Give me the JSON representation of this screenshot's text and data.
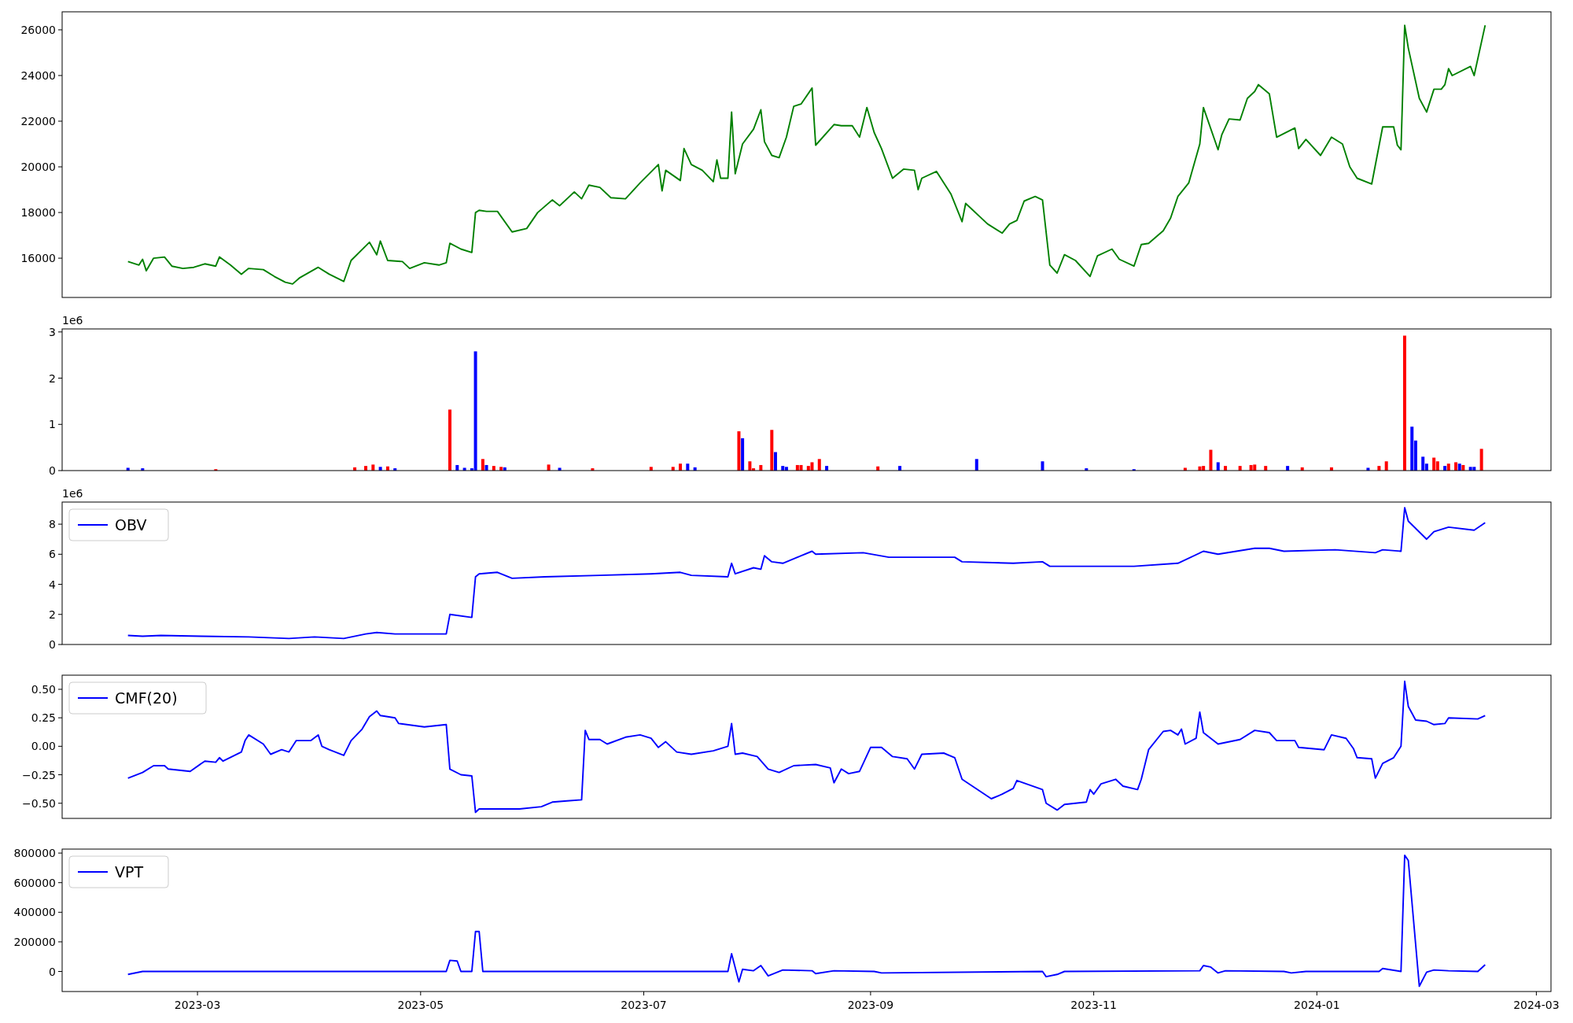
{
  "panels": [
    {
      "chart_data": {
        "type": "line",
        "xlim": [
          "2023-01-23",
          "2024-03-05"
        ],
        "ylim": [
          14280,
          26790
        ],
        "yticks": [
          16000,
          18000,
          20000,
          22000,
          24000,
          26000
        ],
        "x": [
          "2023-02-10",
          "2023-02-13",
          "2023-02-14",
          "2023-02-15",
          "2023-02-17",
          "2023-02-20",
          "2023-02-22",
          "2023-02-25",
          "2023-02-28",
          "2023-03-03",
          "2023-03-06",
          "2023-03-07",
          "2023-03-10",
          "2023-03-13",
          "2023-03-15",
          "2023-03-19",
          "2023-03-22",
          "2023-03-25",
          "2023-03-27",
          "2023-03-29",
          "2023-04-03",
          "2023-04-06",
          "2023-04-10",
          "2023-04-12",
          "2023-04-17",
          "2023-04-19",
          "2023-04-20",
          "2023-04-22",
          "2023-04-26",
          "2023-04-28",
          "2023-05-02",
          "2023-05-06",
          "2023-05-08",
          "2023-05-09",
          "2023-05-12",
          "2023-05-15",
          "2023-05-16",
          "2023-05-17",
          "2023-05-19",
          "2023-05-22",
          "2023-05-26",
          "2023-05-30",
          "2023-06-02",
          "2023-06-06",
          "2023-06-08",
          "2023-06-12",
          "2023-06-14",
          "2023-06-16",
          "2023-06-19",
          "2023-06-22",
          "2023-06-26",
          "2023-06-30",
          "2023-07-05",
          "2023-07-06",
          "2023-07-07",
          "2023-07-11",
          "2023-07-12",
          "2023-07-14",
          "2023-07-17",
          "2023-07-20",
          "2023-07-21",
          "2023-07-22",
          "2023-07-24",
          "2023-07-25",
          "2023-07-26",
          "2023-07-28",
          "2023-07-31",
          "2023-08-02",
          "2023-08-03",
          "2023-08-05",
          "2023-08-07",
          "2023-08-09",
          "2023-08-11",
          "2023-08-13",
          "2023-08-16",
          "2023-08-17",
          "2023-08-22",
          "2023-08-24",
          "2023-08-27",
          "2023-08-29",
          "2023-08-31",
          "2023-09-02",
          "2023-09-04",
          "2023-09-07",
          "2023-09-10",
          "2023-09-13",
          "2023-09-14",
          "2023-09-15",
          "2023-09-19",
          "2023-09-23",
          "2023-09-26",
          "2023-09-27",
          "2023-10-03",
          "2023-10-07",
          "2023-10-09",
          "2023-10-11",
          "2023-10-13",
          "2023-10-16",
          "2023-10-18",
          "2023-10-20",
          "2023-10-22",
          "2023-10-24",
          "2023-10-27",
          "2023-10-31",
          "2023-11-02",
          "2023-11-06",
          "2023-11-08",
          "2023-11-12",
          "2023-11-14",
          "2023-11-16",
          "2023-11-20",
          "2023-11-22",
          "2023-11-24",
          "2023-11-27",
          "2023-11-30",
          "2023-12-01",
          "2023-12-05",
          "2023-12-06",
          "2023-12-08",
          "2023-12-11",
          "2023-12-13",
          "2023-12-15",
          "2023-12-16",
          "2023-12-19",
          "2023-12-21",
          "2023-12-26",
          "2023-12-27",
          "2023-12-29",
          "2024-01-02",
          "2024-01-05",
          "2024-01-08",
          "2024-01-10",
          "2024-01-12",
          "2024-01-16",
          "2024-01-19",
          "2024-01-22",
          "2024-01-23",
          "2024-01-24",
          "2024-01-25",
          "2024-01-26",
          "2024-01-29",
          "2024-01-31",
          "2024-02-02",
          "2024-02-04",
          "2024-02-05",
          "2024-02-06",
          "2024-02-07",
          "2024-02-12",
          "2024-02-13",
          "2024-02-16"
        ],
        "series": [
          {
            "color": "#008000",
            "values": [
              15850,
              15700,
              15950,
              15450,
              16000,
              16050,
              15650,
              15550,
              15600,
              15750,
              15650,
              16050,
              15700,
              15300,
              15550,
              15500,
              15200,
              14950,
              14870,
              15150,
              15600,
              15300,
              14980,
              15900,
              16700,
              16150,
              16750,
              15900,
              15850,
              15550,
              15800,
              15700,
              15800,
              16650,
              16400,
              16250,
              18000,
              18100,
              18050,
              18050,
              17150,
              17300,
              18000,
              18550,
              18300,
              18900,
              18600,
              19200,
              19100,
              18650,
              18600,
              19300,
              20100,
              18950,
              19850,
              19400,
              20800,
              20100,
              19850,
              19350,
              20300,
              19500,
              19500,
              22400,
              19700,
              21000,
              21650,
              22500,
              21100,
              20500,
              20400,
              21300,
              22650,
              22750,
              23450,
              20950,
              21850,
              21800,
              21800,
              21300,
              22600,
              21500,
              20800,
              19500,
              19900,
              19850,
              19000,
              19500,
              19800,
              18800,
              17600,
              18400,
              17500,
              17100,
              17500,
              17650,
              18500,
              18700,
              18550,
              15700,
              15350,
              16150,
              15900,
              15200,
              16100,
              16400,
              15950,
              15650,
              16600,
              16650,
              17200,
              17750,
              18700,
              19300,
              21000,
              22600,
              20750,
              21400,
              22100,
              22050,
              23000,
              23300,
              23600,
              23200,
              21300,
              21700,
              20800,
              21200,
              20500,
              21300,
              21000,
              20000,
              19500,
              19250,
              21750,
              21750,
              20950,
              20750,
              26200,
              25200,
              23000,
              22400,
              23400,
              23400,
              23600,
              24300,
              24000,
              24400,
              24000,
              26200
            ]
          }
        ]
      }
    },
    {
      "axis_offset": "1e6",
      "chart_data": {
        "type": "bar",
        "xlim": [
          "2023-01-23",
          "2024-03-05"
        ],
        "ylim": [
          0,
          3.065
        ],
        "yticks": [
          0,
          1,
          2,
          3
        ],
        "x": [
          "2023-02-10",
          "2023-02-14",
          "2023-03-06",
          "2023-04-13",
          "2023-04-16",
          "2023-04-18",
          "2023-04-20",
          "2023-04-22",
          "2023-04-24",
          "2023-05-09",
          "2023-05-11",
          "2023-05-13",
          "2023-05-15",
          "2023-05-16",
          "2023-05-18",
          "2023-05-19",
          "2023-05-21",
          "2023-05-23",
          "2023-05-24",
          "2023-06-05",
          "2023-06-08",
          "2023-06-17",
          "2023-07-03",
          "2023-07-09",
          "2023-07-11",
          "2023-07-13",
          "2023-07-15",
          "2023-07-27",
          "2023-07-28",
          "2023-07-30",
          "2023-07-31",
          "2023-08-02",
          "2023-08-05",
          "2023-08-06",
          "2023-08-08",
          "2023-08-09",
          "2023-08-12",
          "2023-08-13",
          "2023-08-15",
          "2023-08-16",
          "2023-08-18",
          "2023-08-20",
          "2023-09-03",
          "2023-09-09",
          "2023-09-30",
          "2023-10-18",
          "2023-10-30",
          "2023-11-12",
          "2023-11-26",
          "2023-11-30",
          "2023-12-01",
          "2023-12-03",
          "2023-12-05",
          "2023-12-07",
          "2023-12-11",
          "2023-12-14",
          "2023-12-15",
          "2023-12-18",
          "2023-12-24",
          "2023-12-28",
          "2024-01-05",
          "2024-01-15",
          "2024-01-18",
          "2024-01-20",
          "2024-01-25",
          "2024-01-27",
          "2024-01-28",
          "2024-01-30",
          "2024-01-31",
          "2024-02-02",
          "2024-02-03",
          "2024-02-05",
          "2024-02-06",
          "2024-02-08",
          "2024-02-09",
          "2024-02-10",
          "2024-02-12",
          "2024-02-13",
          "2024-02-15"
        ],
        "series": [
          {
            "color": "#ff0000",
            "values": [
              null,
              null,
              0.03,
              0.07,
              0.1,
              0.13,
              null,
              0.09,
              null,
              1.32,
              null,
              null,
              null,
              null,
              0.25,
              null,
              0.1,
              0.08,
              null,
              0.13,
              null,
              0.05,
              0.08,
              0.08,
              0.15,
              null,
              null,
              0.85,
              null,
              0.2,
              0.05,
              0.12,
              0.88,
              null,
              null,
              null,
              0.12,
              0.12,
              0.1,
              0.18,
              0.25,
              null,
              0.09,
              null,
              null,
              null,
              null,
              null,
              0.06,
              0.09,
              0.1,
              0.45,
              null,
              0.1,
              0.1,
              0.12,
              0.13,
              0.1,
              null,
              0.07,
              0.07,
              null,
              0.1,
              0.2,
              2.92,
              null,
              null,
              null,
              null,
              0.28,
              0.2,
              null,
              0.15,
              0.18,
              null,
              0.12,
              null,
              null,
              0.47
            ]
          },
          {
            "color": "#0000ff",
            "values": [
              0.06,
              0.05,
              null,
              null,
              null,
              null,
              0.08,
              null,
              0.05,
              null,
              0.12,
              0.06,
              0.05,
              2.58,
              null,
              0.12,
              null,
              null,
              0.07,
              null,
              0.06,
              null,
              null,
              null,
              null,
              0.15,
              0.07,
              null,
              0.7,
              null,
              null,
              null,
              null,
              0.4,
              0.1,
              0.08,
              null,
              null,
              null,
              null,
              null,
              0.1,
              null,
              0.1,
              0.25,
              0.2,
              0.05,
              0.03,
              null,
              null,
              null,
              null,
              0.18,
              null,
              null,
              null,
              null,
              null,
              0.1,
              null,
              null,
              0.06,
              null,
              null,
              null,
              0.95,
              0.65,
              0.3,
              0.15,
              null,
              null,
              0.1,
              null,
              null,
              0.15,
              null,
              0.08,
              0.08,
              null
            ]
          }
        ]
      }
    },
    {
      "axis_offset": "1e6",
      "chart_data": {
        "type": "line",
        "xlim": [
          "2023-01-23",
          "2024-03-05"
        ],
        "ylim": [
          0,
          9.47
        ],
        "yticks": [
          0,
          2,
          4,
          6,
          8
        ],
        "x": [
          "2023-02-10",
          "2023-02-14",
          "2023-02-19",
          "2023-03-02",
          "2023-03-15",
          "2023-03-26",
          "2023-04-02",
          "2023-04-10",
          "2023-04-16",
          "2023-04-19",
          "2023-04-24",
          "2023-05-08",
          "2023-05-09",
          "2023-05-15",
          "2023-05-16",
          "2023-05-17",
          "2023-05-22",
          "2023-05-26",
          "2023-06-04",
          "2023-06-19",
          "2023-07-03",
          "2023-07-11",
          "2023-07-14",
          "2023-07-24",
          "2023-07-25",
          "2023-07-26",
          "2023-07-31",
          "2023-08-02",
          "2023-08-03",
          "2023-08-05",
          "2023-08-08",
          "2023-08-12",
          "2023-08-16",
          "2023-08-17",
          "2023-08-30",
          "2023-09-06",
          "2023-09-24",
          "2023-09-26",
          "2023-10-10",
          "2023-10-18",
          "2023-10-20",
          "2023-11-12",
          "2023-11-24",
          "2023-12-01",
          "2023-12-05",
          "2023-12-15",
          "2023-12-19",
          "2023-12-23",
          "2024-01-06",
          "2024-01-17",
          "2024-01-19",
          "2024-01-24",
          "2024-01-25",
          "2024-01-26",
          "2024-01-31",
          "2024-02-02",
          "2024-02-06",
          "2024-02-13",
          "2024-02-16"
        ],
        "series": [
          {
            "name": "OBV",
            "color": "#0000ff",
            "values": [
              0.6,
              0.55,
              0.6,
              0.55,
              0.5,
              0.4,
              0.5,
              0.4,
              0.7,
              0.8,
              0.7,
              0.7,
              2.0,
              1.8,
              4.5,
              4.7,
              4.8,
              4.4,
              4.5,
              4.6,
              4.7,
              4.8,
              4.6,
              4.5,
              5.4,
              4.7,
              5.1,
              5.0,
              5.9,
              5.5,
              5.4,
              5.8,
              6.2,
              6.0,
              6.1,
              5.8,
              5.8,
              5.5,
              5.4,
              5.5,
              5.2,
              5.2,
              5.4,
              6.2,
              6.0,
              6.4,
              6.4,
              6.2,
              6.3,
              6.1,
              6.3,
              6.2,
              9.1,
              8.2,
              7.0,
              7.5,
              7.8,
              7.6,
              8.1
            ]
          }
        ]
      }
    },
    {
      "chart_data": {
        "type": "line",
        "xlim": [
          "2023-01-23",
          "2024-03-05"
        ],
        "ylim": [
          -0.633,
          0.624
        ],
        "yticks": [
          {
            "value": -0.5,
            "label": "−0.50"
          },
          {
            "value": -0.25,
            "label": "−0.25"
          },
          {
            "value": 0,
            "label": "0.00"
          },
          {
            "value": 0.25,
            "label": "0.25"
          },
          {
            "value": 0.5,
            "label": "0.50"
          }
        ],
        "x": [
          "2023-02-10",
          "2023-02-14",
          "2023-02-17",
          "2023-02-20",
          "2023-02-21",
          "2023-02-27",
          "2023-03-03",
          "2023-03-06",
          "2023-03-07",
          "2023-03-08",
          "2023-03-13",
          "2023-03-14",
          "2023-03-15",
          "2023-03-19",
          "2023-03-21",
          "2023-03-24",
          "2023-03-26",
          "2023-03-28",
          "2023-04-01",
          "2023-04-03",
          "2023-04-04",
          "2023-04-06",
          "2023-04-10",
          "2023-04-12",
          "2023-04-15",
          "2023-04-17",
          "2023-04-19",
          "2023-04-20",
          "2023-04-24",
          "2023-04-25",
          "2023-05-02",
          "2023-05-08",
          "2023-05-09",
          "2023-05-12",
          "2023-05-15",
          "2023-05-16",
          "2023-05-17",
          "2023-05-28",
          "2023-06-03",
          "2023-06-06",
          "2023-06-10",
          "2023-06-14",
          "2023-06-15",
          "2023-06-16",
          "2023-06-19",
          "2023-06-21",
          "2023-06-26",
          "2023-06-30",
          "2023-07-03",
          "2023-07-05",
          "2023-07-07",
          "2023-07-10",
          "2023-07-14",
          "2023-07-20",
          "2023-07-24",
          "2023-07-25",
          "2023-07-26",
          "2023-07-28",
          "2023-08-01",
          "2023-08-04",
          "2023-08-07",
          "2023-08-11",
          "2023-08-17",
          "2023-08-21",
          "2023-08-22",
          "2023-08-24",
          "2023-08-26",
          "2023-08-29",
          "2023-09-01",
          "2023-09-04",
          "2023-09-07",
          "2023-09-11",
          "2023-09-13",
          "2023-09-15",
          "2023-09-21",
          "2023-09-24",
          "2023-09-26",
          "2023-10-04",
          "2023-10-07",
          "2023-10-10",
          "2023-10-11",
          "2023-10-18",
          "2023-10-19",
          "2023-10-22",
          "2023-10-24",
          "2023-10-30",
          "2023-10-31",
          "2023-11-01",
          "2023-11-03",
          "2023-11-07",
          "2023-11-09",
          "2023-11-13",
          "2023-11-14",
          "2023-11-16",
          "2023-11-20",
          "2023-11-22",
          "2023-11-24",
          "2023-11-25",
          "2023-11-26",
          "2023-11-29",
          "2023-11-30",
          "2023-12-01",
          "2023-12-05",
          "2023-12-11",
          "2023-12-15",
          "2023-12-19",
          "2023-12-21",
          "2023-12-26",
          "2023-12-27",
          "2024-01-03",
          "2024-01-05",
          "2024-01-09",
          "2024-01-11",
          "2024-01-12",
          "2024-01-16",
          "2024-01-17",
          "2024-01-19",
          "2024-01-22",
          "2024-01-24",
          "2024-01-25",
          "2024-01-26",
          "2024-01-28",
          "2024-01-31",
          "2024-02-02",
          "2024-02-05",
          "2024-02-06",
          "2024-02-14",
          "2024-02-16"
        ],
        "series": [
          {
            "name": "CMF(20)",
            "color": "#0000ff",
            "values": [
              -0.28,
              -0.23,
              -0.17,
              -0.17,
              -0.2,
              -0.22,
              -0.13,
              -0.14,
              -0.1,
              -0.13,
              -0.05,
              0.05,
              0.1,
              0.02,
              -0.07,
              -0.03,
              -0.05,
              0.05,
              0.05,
              0.1,
              0,
              -0.03,
              -0.08,
              0.05,
              0.15,
              0.26,
              0.31,
              0.27,
              0.25,
              0.2,
              0.17,
              0.19,
              -0.2,
              -0.25,
              -0.26,
              -0.58,
              -0.55,
              -0.55,
              -0.53,
              -0.49,
              -0.48,
              -0.47,
              0.14,
              0.06,
              0.06,
              0.02,
              0.08,
              0.1,
              0.07,
              -0.01,
              0.04,
              -0.05,
              -0.07,
              -0.04,
              0,
              0.2,
              -0.07,
              -0.06,
              -0.09,
              -0.2,
              -0.23,
              -0.17,
              -0.16,
              -0.19,
              -0.32,
              -0.2,
              -0.24,
              -0.22,
              -0.01,
              -0.01,
              -0.09,
              -0.11,
              -0.2,
              -0.07,
              -0.06,
              -0.1,
              -0.29,
              -0.46,
              -0.42,
              -0.37,
              -0.3,
              -0.38,
              -0.5,
              -0.56,
              -0.51,
              -0.49,
              -0.38,
              -0.42,
              -0.33,
              -0.29,
              -0.35,
              -0.38,
              -0.29,
              -0.03,
              0.13,
              0.14,
              0.1,
              0.15,
              0.02,
              0.07,
              0.3,
              0.12,
              0.02,
              0.06,
              0.14,
              0.12,
              0.05,
              0.05,
              -0.01,
              -0.03,
              0.1,
              0.07,
              -0.02,
              -0.1,
              -0.11,
              -0.28,
              -0.15,
              -0.1,
              0,
              0.57,
              0.35,
              0.23,
              0.22,
              0.19,
              0.2,
              0.25,
              0.24,
              0.27
            ]
          }
        ]
      }
    },
    {
      "chart_data": {
        "type": "line",
        "xlim": [
          "2023-01-23",
          "2024-03-05"
        ],
        "ylim": [
          -135600,
          827000
        ],
        "yticks": [
          0,
          200000,
          400000,
          600000,
          800000
        ],
        "xticks": [
          {
            "value": "2023-03-01",
            "label": "2023-03"
          },
          {
            "value": "2023-05-01",
            "label": "2023-05"
          },
          {
            "value": "2023-07-01",
            "label": "2023-07"
          },
          {
            "value": "2023-09-01",
            "label": "2023-09"
          },
          {
            "value": "2023-11-01",
            "label": "2023-11"
          },
          {
            "value": "2024-01-01",
            "label": "2024-01"
          },
          {
            "value": "2024-03-01",
            "label": "2024-03"
          }
        ],
        "x": [
          "2023-02-10",
          "2023-02-14",
          "2023-02-21",
          "2023-04-12",
          "2023-05-08",
          "2023-05-09",
          "2023-05-11",
          "2023-05-12",
          "2023-05-15",
          "2023-05-16",
          "2023-05-17",
          "2023-05-18",
          "2023-06-19",
          "2023-07-24",
          "2023-07-25",
          "2023-07-27",
          "2023-07-28",
          "2023-07-31",
          "2023-08-02",
          "2023-08-04",
          "2023-08-08",
          "2023-08-16",
          "2023-08-17",
          "2023-08-22",
          "2023-09-02",
          "2023-09-04",
          "2023-10-18",
          "2023-10-19",
          "2023-10-22",
          "2023-10-24",
          "2023-11-30",
          "2023-12-01",
          "2023-12-03",
          "2023-12-05",
          "2023-12-07",
          "2023-12-23",
          "2023-12-25",
          "2023-12-29",
          "2024-01-18",
          "2024-01-19",
          "2024-01-24",
          "2024-01-25",
          "2024-01-26",
          "2024-01-29",
          "2024-01-31",
          "2024-02-02",
          "2024-02-06",
          "2024-02-14",
          "2024-02-16"
        ],
        "series": [
          {
            "name": "VPT",
            "color": "#0000ff",
            "values": [
              -20000,
              0,
              0,
              0,
              0,
              75000,
              70000,
              0,
              0,
              270000,
              270000,
              0,
              0,
              0,
              120000,
              -70000,
              15000,
              5000,
              40000,
              -30000,
              10000,
              5000,
              -15000,
              5000,
              0,
              -10000,
              0,
              -35000,
              -20000,
              0,
              5000,
              40000,
              30000,
              -10000,
              5000,
              0,
              -10000,
              0,
              0,
              20000,
              0,
              785000,
              750000,
              -100000,
              -5000,
              10000,
              5000,
              0,
              45000
            ]
          }
        ]
      }
    }
  ]
}
